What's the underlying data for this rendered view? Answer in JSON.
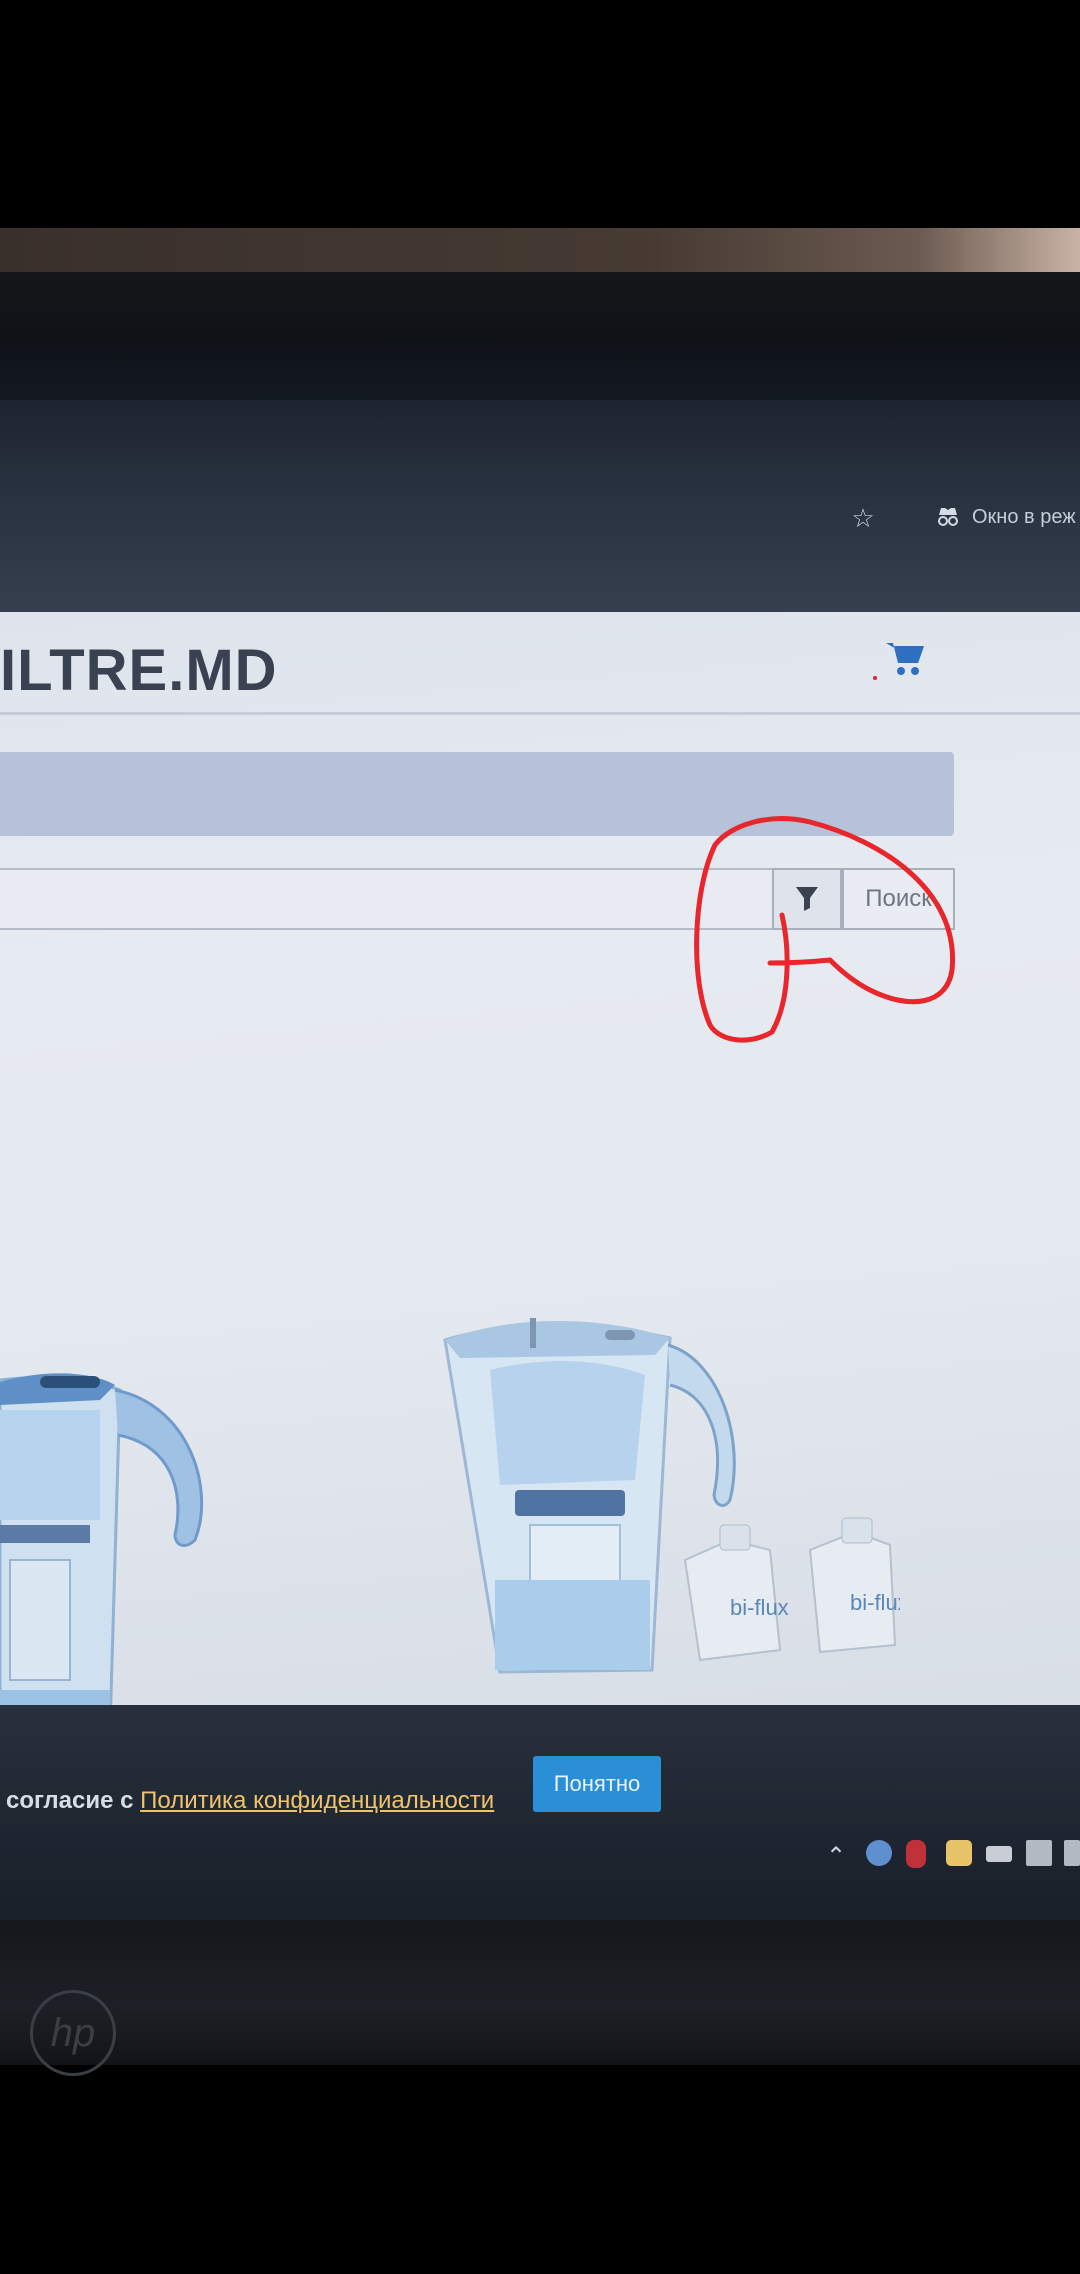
{
  "browser": {
    "incognito_label": "Окно в реж",
    "bookmark_icon": "star-icon",
    "incognito_icon": "incognito-icon"
  },
  "site": {
    "logo": "ILTRE.MD",
    "cart_icon": "cart-icon"
  },
  "search": {
    "filter_icon": "funnel-icon",
    "button_label": "Поиск"
  },
  "products": {
    "right_cartridge_labels": [
      "bi-flux",
      "bi-flux"
    ]
  },
  "cookie": {
    "text_before_link": "согласие с ",
    "link_text": "Политика конфиденциальности",
    "accept_label": "Понятно"
  },
  "colors": {
    "accent": "#2a8fd6",
    "annotation": "#e8262c",
    "banner": "#b5c2d8",
    "logo": "#3a4150"
  }
}
